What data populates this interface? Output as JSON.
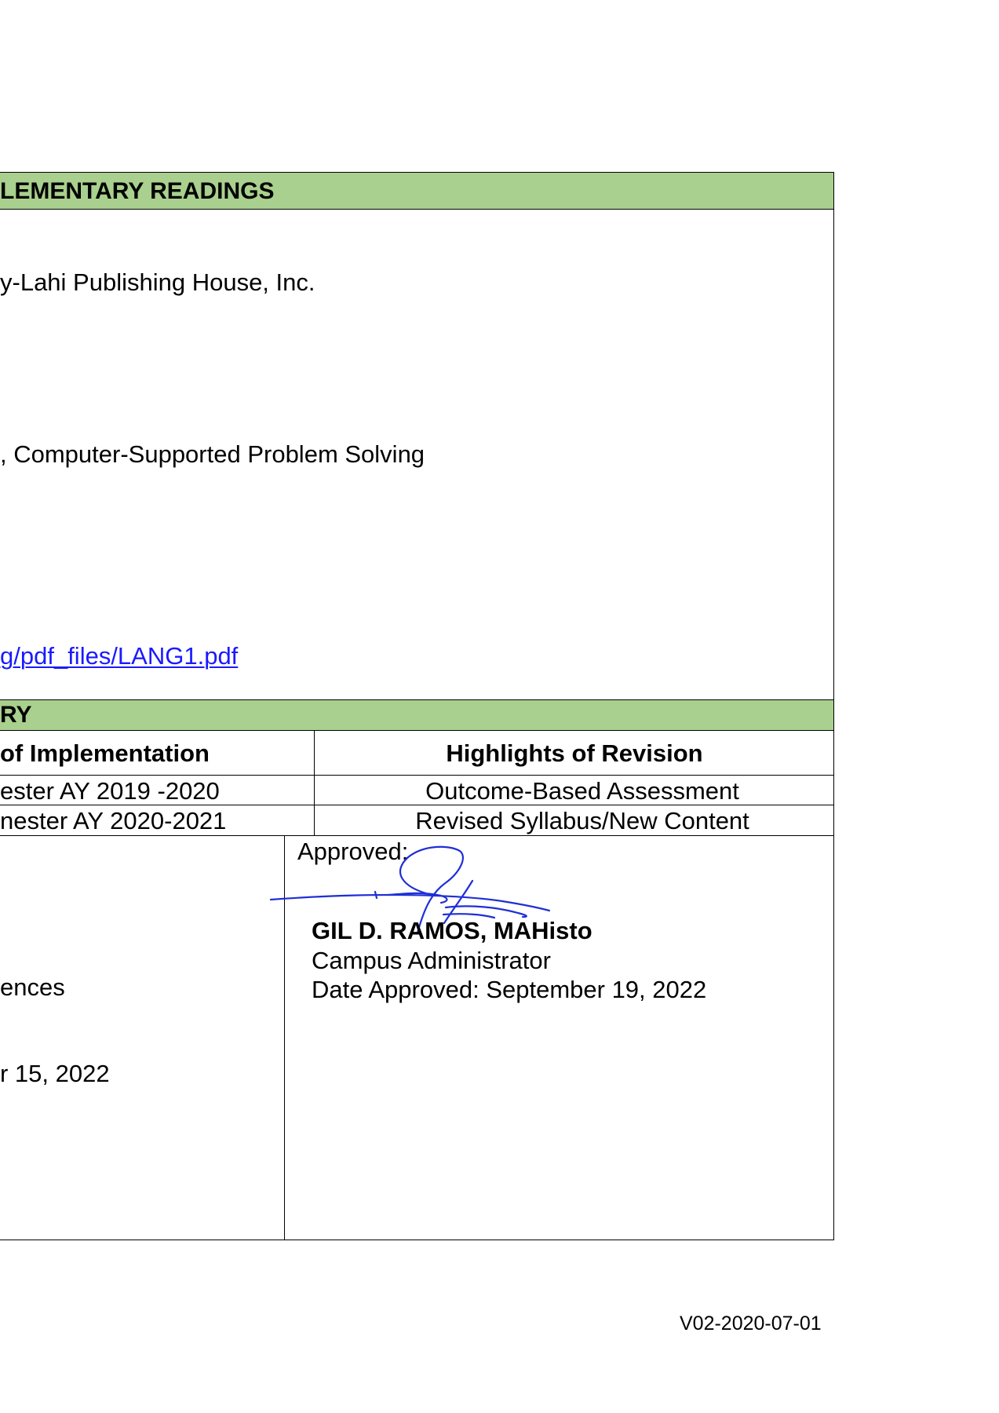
{
  "readings": {
    "header": "LEMENTARY READINGS",
    "lines": [
      "y-Lahi Publishing House, Inc.",
      ", Computer-Supported Problem Solving"
    ],
    "link": "g/pdf_files/LANG1.pdf"
  },
  "history": {
    "header": "RY",
    "columns": [
      "of Implementation",
      "Highlights of Revision"
    ],
    "rows": [
      [
        "ester AY 2019 -2020",
        "Outcome-Based Assessment"
      ],
      [
        "nester AY 2020-2021",
        "Revised Syllabus/New Content"
      ]
    ]
  },
  "signoff": {
    "left": {
      "line1": "ences",
      "line2": "r 15, 2022"
    },
    "right": {
      "label": "Approved:",
      "name": "GIL D. RAMOS, MAHisto",
      "position": "Campus Administrator",
      "date": "Date Approved: September 19, 2022"
    }
  },
  "footer": {
    "version": "V02-2020-07-01"
  }
}
